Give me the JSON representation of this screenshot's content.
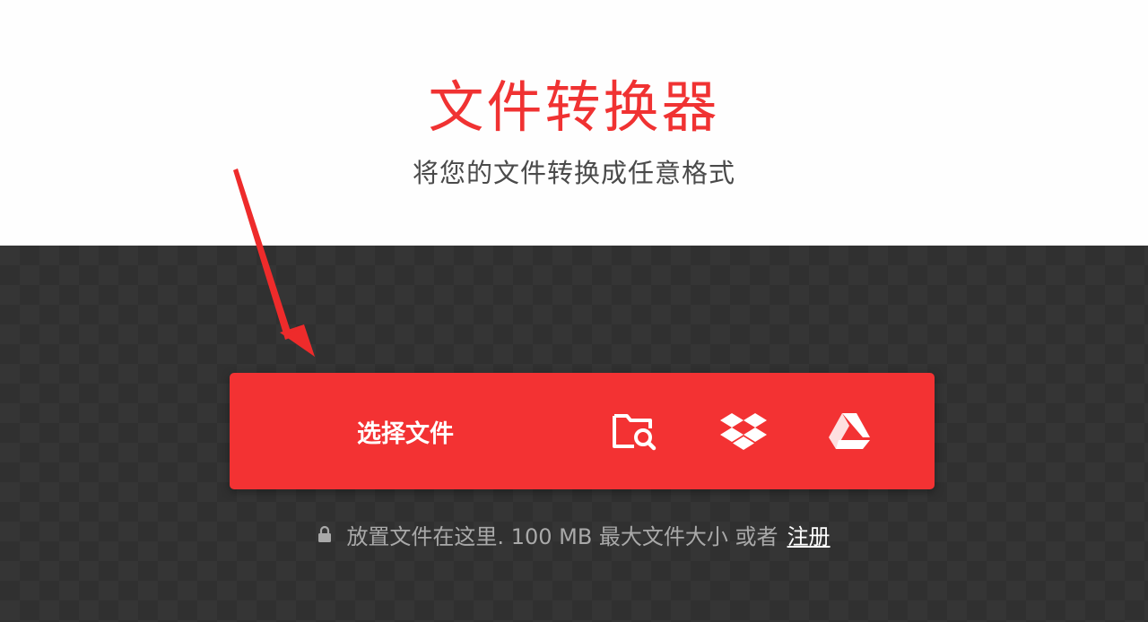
{
  "hero": {
    "title": "文件转换器",
    "subtitle": "将您的文件转换成任意格式"
  },
  "upload": {
    "choose_file_label": "选择文件",
    "sources": [
      {
        "icon": "folder-search-icon"
      },
      {
        "icon": "dropbox-icon"
      },
      {
        "icon": "google-drive-icon"
      }
    ]
  },
  "drop_note": {
    "text": "放置文件在这里. 100 MB 最大文件大小 或者",
    "signup_label": "注册"
  },
  "colors": {
    "brand": "#f33233",
    "dark_bg": "#353535",
    "annotation": "#ee2b2b"
  }
}
